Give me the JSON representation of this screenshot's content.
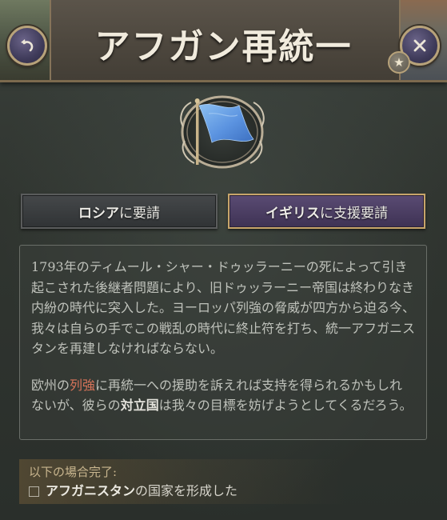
{
  "header": {
    "title": "アフガン再統一",
    "back_icon": "back-arrow-icon",
    "close_icon": "close-icon",
    "star_icon": "star-icon"
  },
  "emblem": {
    "icon": "blue-flag-icon",
    "flag_color": "#6fa6e8"
  },
  "choices": {
    "russia": {
      "label_bold": "ロシア",
      "label_suffix": "に要請"
    },
    "britain": {
      "label_bold": "イギリス",
      "label_suffix": "に支援要請"
    }
  },
  "description": {
    "paragraph1": "1793年のティムール・シャー・ドゥッラーニーの死によって引き起こされた後継者問題により、旧ドゥッラーニー帝国は終わりなき内紛の時代に突入した。ヨーロッパ列強の脅威が四方から迫る今、我々は自らの手でこの戦乱の時代に終止符を打ち、統一アフガニスタンを再建しなければならない。",
    "p2_part1": "欧州の",
    "p2_highlight1": "列強",
    "p2_part2": "に再統一への援助を訴えれば支持を得られるかもしれないが、彼らの",
    "p2_highlight2": "対立国",
    "p2_part3": "は我々の目標を妨げようとしてくるだろう。"
  },
  "condition": {
    "title": "以下の場合完了:",
    "item_bold": "アフガニスタン",
    "item_suffix": "の国家を形成した"
  },
  "colors": {
    "accent_gold": "#c7a56a",
    "highlight_red": "#d9745a",
    "britain_purple": "#4c3e63"
  }
}
